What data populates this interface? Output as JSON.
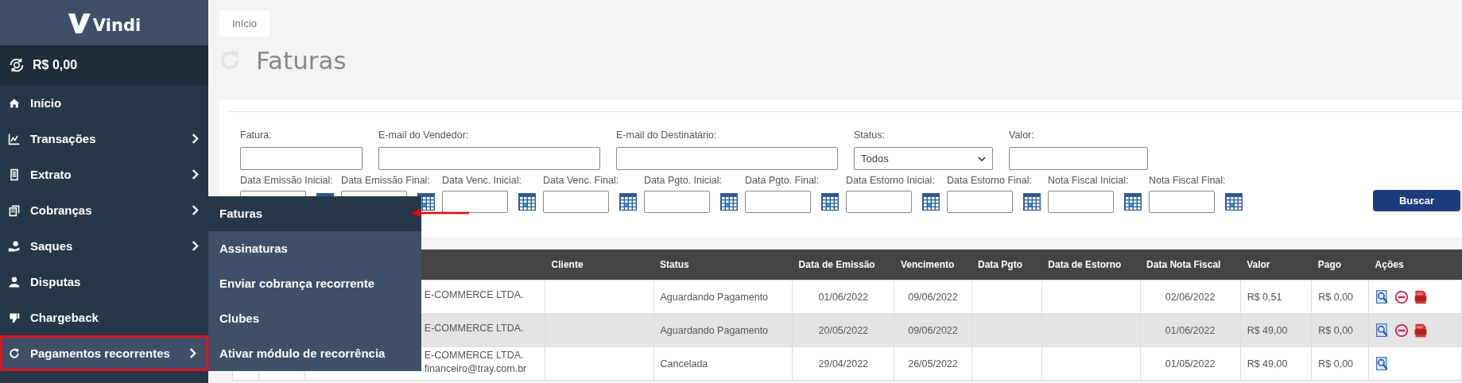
{
  "sidebar": {
    "logo": "Vindi",
    "balance": "R$ 0,00",
    "items": [
      {
        "label": "Início",
        "has_submenu": false,
        "selected": false
      },
      {
        "label": "Transações",
        "has_submenu": true,
        "selected": false
      },
      {
        "label": "Extrato",
        "has_submenu": true,
        "selected": false
      },
      {
        "label": "Cobranças",
        "has_submenu": true,
        "selected": false
      },
      {
        "label": "Saques",
        "has_submenu": true,
        "selected": false
      },
      {
        "label": "Disputas",
        "has_submenu": false,
        "selected": false
      },
      {
        "label": "Chargeback",
        "has_submenu": false,
        "selected": false
      },
      {
        "label": "Pagamentos recorrentes",
        "has_submenu": true,
        "selected": true
      }
    ]
  },
  "submenu": {
    "items": [
      {
        "label": "Faturas",
        "selected": true
      },
      {
        "label": "Assinaturas",
        "selected": false
      },
      {
        "label": "Enviar cobrança recorrente",
        "selected": false
      },
      {
        "label": "Clubes",
        "selected": false
      },
      {
        "label": "Ativar módulo de recorrência",
        "selected": false
      }
    ]
  },
  "breadcrumb": "Início",
  "page_title": "Faturas",
  "filters": {
    "row_1": [
      {
        "label": "Fatura:",
        "kind": "text"
      },
      {
        "label": "E-mail do Vendedor:",
        "kind": "text"
      },
      {
        "label": "E-mail do Destinatário:",
        "kind": "text"
      },
      {
        "label": "Status:",
        "kind": "select",
        "value": "Todos"
      },
      {
        "label": "Valor:",
        "kind": "text"
      }
    ],
    "row_2": [
      {
        "label": "Data Emissão Inicial:",
        "kind": "date"
      },
      {
        "label": "Data Emissão Final:",
        "kind": "date"
      },
      {
        "label": "Data Venc. Inicial:",
        "kind": "date"
      },
      {
        "label": "Data Venc. Final:",
        "kind": "date"
      },
      {
        "label": "Data Pgto. Inicial:",
        "kind": "date"
      },
      {
        "label": "Data Pgto. Final:",
        "kind": "date"
      },
      {
        "label": "Data Estorno Inicial:",
        "kind": "date"
      },
      {
        "label": "Data Estorno Final:",
        "kind": "date"
      },
      {
        "label": "Nota Fiscal Inicial:",
        "kind": "date"
      },
      {
        "label": "Nota Fiscal Final:",
        "kind": "date"
      }
    ],
    "search_button": "Buscar"
  },
  "table": {
    "columns": [
      {},
      {},
      {},
      {
        "label": "Cliente"
      },
      {
        "label": "Status"
      },
      {
        "label": "Data de Emissão"
      },
      {
        "label": "Vencimento"
      },
      {
        "label": "Data Pgto"
      },
      {
        "label": "Data de Estorno"
      },
      {
        "label": "Data Nota Fiscal"
      },
      {
        "label": "Valor"
      },
      {
        "label": "Pago"
      },
      {
        "label": "Ações"
      }
    ],
    "rows": [
      {
        "seller": "E-COMMERCE LTDA.",
        "status": "Aguardando Pagamento",
        "emissao": "01/06/2022",
        "vencimento": "09/06/2022",
        "nota_fiscal": "02/06/2022",
        "valor": "R$ 0,51",
        "pago": "R$ 0,00",
        "actions": [
          {
            "kind": "view"
          },
          {
            "kind": "cancel"
          },
          {
            "kind": "pdf"
          }
        ]
      },
      {
        "seller": "E-COMMERCE LTDA.",
        "status": "Aguardando Pagamento",
        "emissao": "20/05/2022",
        "vencimento": "09/06/2022",
        "nota_fiscal": "01/06/2022",
        "valor": "R$ 49,00",
        "pago": "R$ 0,00",
        "actions": [
          {
            "kind": "view"
          },
          {
            "kind": "cancel"
          },
          {
            "kind": "pdf"
          }
        ]
      },
      {
        "seller": "E-COMMERCE LTDA.",
        "seller_email": "financeiro@tray.com.br",
        "status": "Cancelada",
        "emissao": "29/04/2022",
        "vencimento": "26/05/2022",
        "nota_fiscal": "01/05/2022",
        "valor": "R$ 49,00",
        "pago": "R$ 0,00",
        "actions": [
          {
            "kind": "view"
          }
        ]
      }
    ]
  }
}
